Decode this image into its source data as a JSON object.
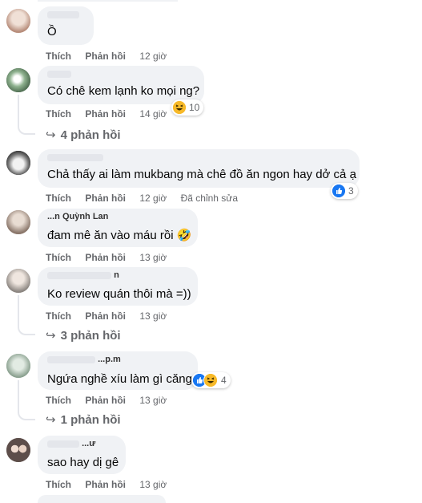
{
  "comments": [
    {
      "id": "c1",
      "author": "",
      "text": "Ồ",
      "actions": {
        "like": "Thích",
        "reply": "Phản hồi",
        "time": "12 giờ"
      },
      "avatar_color": "#d8b9a8"
    },
    {
      "id": "c2",
      "author": "",
      "text": "Có chê kem lạnh ko mọi ng?",
      "actions": {
        "like": "Thích",
        "reply": "Phản hồi",
        "time": "14 giờ"
      },
      "reactions": {
        "types": [
          "haha-icon"
        ],
        "count": "10"
      },
      "replies_label": "4 phản hồi",
      "avatar_color": "#6b8f6e"
    },
    {
      "id": "c3",
      "author": "",
      "text": "Chả thấy ai làm mukbang mà chê đồ ăn ngon hay dở cả ạ",
      "actions": {
        "like": "Thích",
        "reply": "Phản hồi",
        "time": "12 giờ",
        "edited": "Đã chỉnh sửa"
      },
      "reactions": {
        "types": [
          "like-icon"
        ],
        "count": "3"
      },
      "avatar_color": "#2b2b2b"
    },
    {
      "id": "c4",
      "author": "...n Quỳnh Lan",
      "text": "đam mê ăn vào máu rồi 🤣",
      "actions": {
        "like": "Thích",
        "reply": "Phản hồi",
        "time": "13 giờ"
      },
      "avatar_color": "#b9a89a"
    },
    {
      "id": "c5",
      "author": "n",
      "text": "Ko review quán thôi mà =))",
      "actions": {
        "like": "Thích",
        "reply": "Phản hồi",
        "time": "13 giờ"
      },
      "replies_label": "3 phản hồi",
      "avatar_color": "#a8a4a0"
    },
    {
      "id": "c6",
      "author": "...p.m",
      "text": "Ngứa nghề xíu làm gì căng",
      "actions": {
        "like": "Thích",
        "reply": "Phản hồi",
        "time": "13 giờ"
      },
      "reactions": {
        "types": [
          "like-icon",
          "haha-icon"
        ],
        "count": "4"
      },
      "replies_label": "1 phản hồi",
      "avatar_color": "#9fb3a4"
    },
    {
      "id": "c7",
      "author": "...ư",
      "text": "sao hay dị gê",
      "actions": {
        "like": "Thích",
        "reply": "Phản hồi",
        "time": "13 giờ"
      },
      "avatar_color": "#7a6a66"
    }
  ]
}
